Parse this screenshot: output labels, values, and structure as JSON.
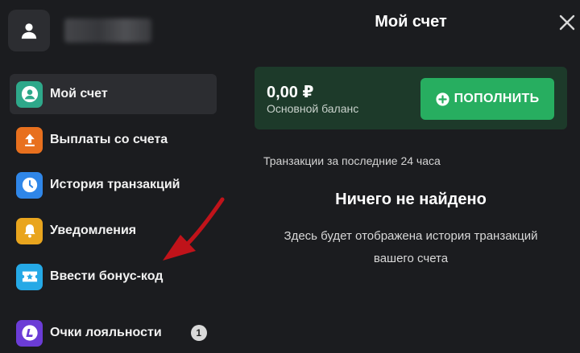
{
  "panel": {
    "title": "Мой счет"
  },
  "sidebar": {
    "items": [
      {
        "label": "Мой счет",
        "icon": "account-icon",
        "color": "#2ea88a",
        "active": true
      },
      {
        "label": "Выплаты со счета",
        "icon": "upload-icon",
        "color": "#e8701e"
      },
      {
        "label": "История транзакций",
        "icon": "clock-icon",
        "color": "#2f86e8"
      },
      {
        "label": "Уведомления",
        "icon": "bell-icon",
        "color": "#e9a51e"
      },
      {
        "label": "Ввести бонус-код",
        "icon": "ticket-icon",
        "color": "#25a9e6"
      },
      {
        "label": "Очки лояльности",
        "icon": "loyalty-icon",
        "color": "#6b3cd6",
        "badge": "1"
      }
    ]
  },
  "balance": {
    "amount": "0,00 ₽",
    "caption": "Основной баланс",
    "deposit_label": "ПОПОЛНИТЬ"
  },
  "transactions": {
    "header": "Транзакции за последние 24 часа",
    "empty_title": "Ничего не найдено",
    "empty_line1": "Здесь будет отображена история транзакций",
    "empty_line2": "вашего счета"
  },
  "colors": {
    "background": "#1b1c1f",
    "card": "#1d3a2a",
    "accent": "#27ae60",
    "arrow": "#c0131a"
  }
}
